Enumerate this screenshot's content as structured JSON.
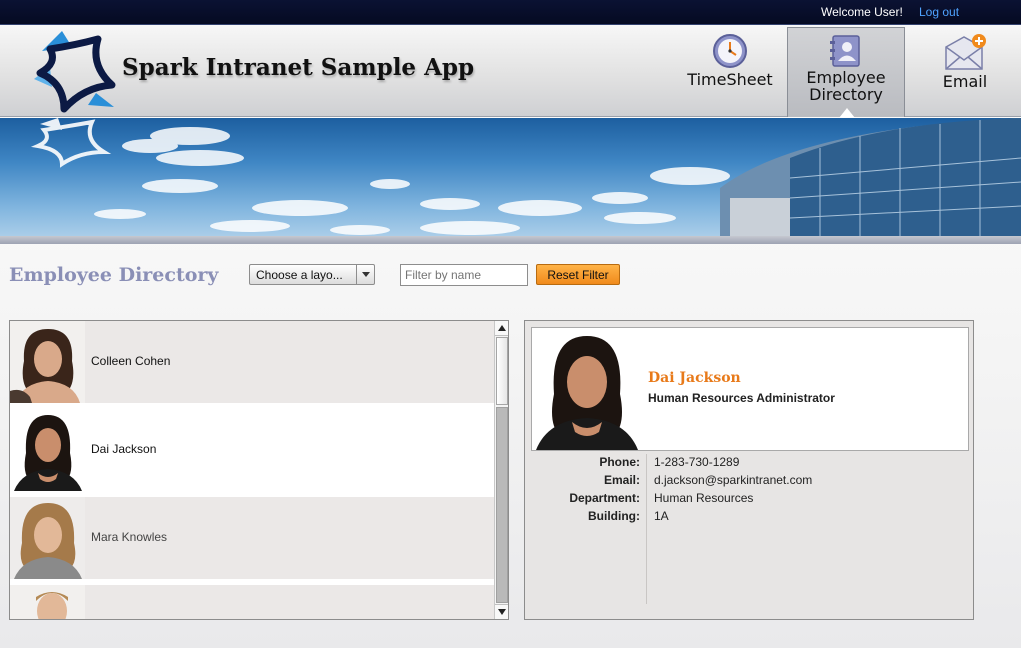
{
  "topbar": {
    "welcome": "Welcome User!",
    "logout": "Log out"
  },
  "header": {
    "app_title": "Spark Intranet Sample App",
    "nav": [
      {
        "label": "TimeSheet",
        "icon": "clock-icon",
        "active": false
      },
      {
        "label_line1": "Employee",
        "label_line2": "Directory",
        "icon": "address-book-icon",
        "active": true
      },
      {
        "label": "Email",
        "icon": "envelope-plus-icon",
        "active": false
      }
    ]
  },
  "page": {
    "heading": "Employee Directory",
    "layout_select": "Choose a layo...",
    "filter_placeholder": "Filter by name",
    "reset_label": "Reset Filter"
  },
  "employees": [
    {
      "name": "Colleen Cohen",
      "selected": false
    },
    {
      "name": "Dai Jackson",
      "selected": true
    },
    {
      "name": "Mara Knowles",
      "selected": false
    },
    {
      "name": "",
      "selected": false
    }
  ],
  "detail": {
    "name": "Dai Jackson",
    "title": "Human Resources Administrator",
    "fields": [
      {
        "label": "Phone:",
        "value": "1-283-730-1289"
      },
      {
        "label": "Email:",
        "value": "d.jackson@sparkintranet.com"
      },
      {
        "label": "Department:",
        "value": "Human Resources"
      },
      {
        "label": "Building:",
        "value": "1A"
      }
    ]
  },
  "colors": {
    "accent_orange": "#e87a1a",
    "heading_purple": "#8a8fb6",
    "topbar": "#0b1233",
    "link": "#4fa3ff"
  }
}
